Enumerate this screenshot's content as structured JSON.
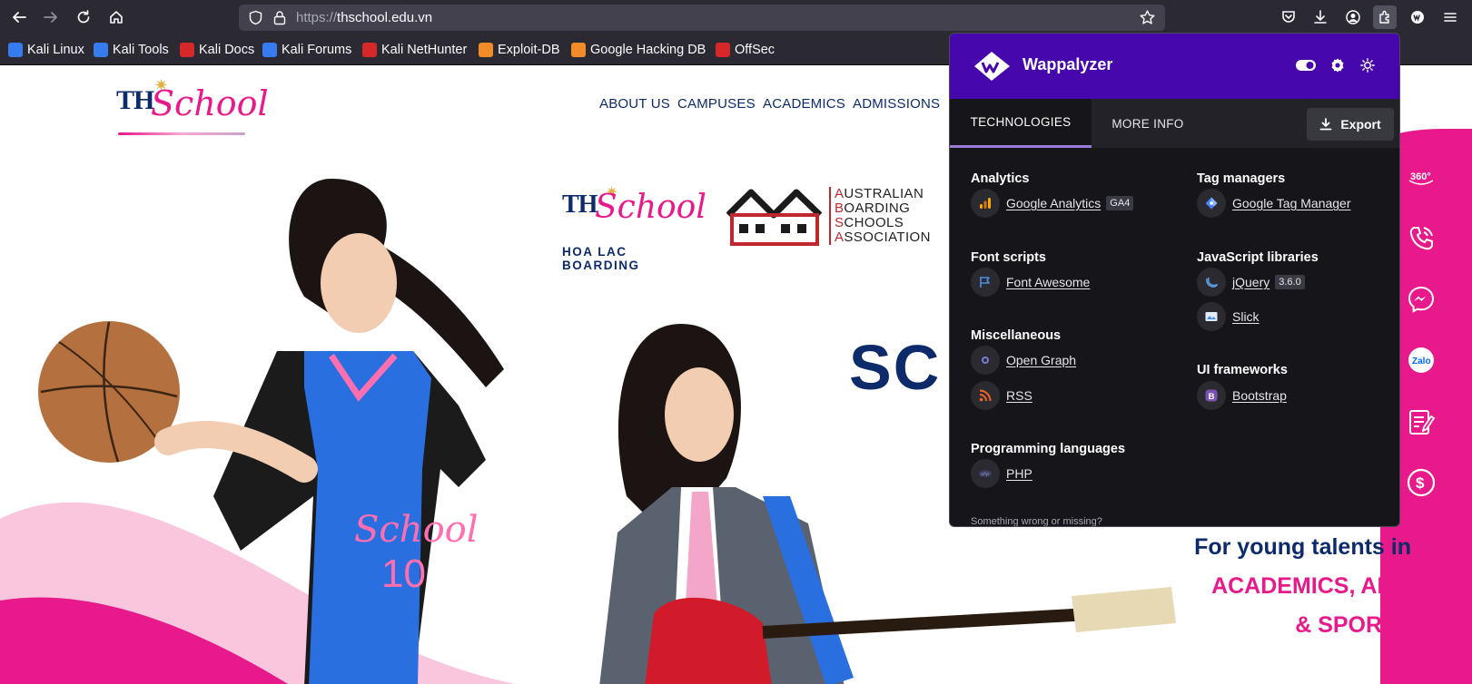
{
  "browser": {
    "url_scheme": "https://",
    "url_host": "thschool.edu.vn",
    "bookmarks": [
      {
        "label": "Kali Linux",
        "color": "#367bf0"
      },
      {
        "label": "Kali Tools",
        "color": "#367bf0"
      },
      {
        "label": "Kali Docs",
        "color": "#d62828"
      },
      {
        "label": "Kali Forums",
        "color": "#367bf0"
      },
      {
        "label": "Kali NetHunter",
        "color": "#d62828"
      },
      {
        "label": "Exploit-DB",
        "color": "#f28c28"
      },
      {
        "label": "Google Hacking DB",
        "color": "#f28c28"
      },
      {
        "label": "OffSec",
        "color": "#d62828"
      }
    ]
  },
  "site": {
    "logo_th": "TH",
    "logo_school": "School",
    "menu": [
      "ABOUT US",
      "CAMPUSES",
      "ACADEMICS",
      "ADMISSIONS"
    ],
    "badge_hlb": "HOA LAC BOARDING",
    "absa_lines": [
      {
        "first": "A",
        "rest": "USTRALIAN"
      },
      {
        "first": "B",
        "rest": "OARDING"
      },
      {
        "first": "S",
        "rest": "CHOOLS"
      },
      {
        "first": "A",
        "rest": "SSOCIATION"
      }
    ],
    "hero_partial": "SC",
    "tagline": [
      "For young talents in",
      "ACADEMICS, ART,",
      "& SPORTS"
    ],
    "side_icons": [
      "360-icon",
      "phone-icon",
      "messenger-icon",
      "zalo-icon",
      "form-icon",
      "dollar-icon"
    ],
    "zalo_label": "Zalo",
    "brand_pink": "#e8198b",
    "brand_navy": "#0d2b6b"
  },
  "wappalyzer": {
    "title": "Wappalyzer",
    "header_color": "#4608ad",
    "tabs": [
      "TECHNOLOGIES",
      "MORE INFO"
    ],
    "export_label": "Export",
    "categories": [
      {
        "title": "Analytics",
        "items": [
          {
            "name": "Google Analytics",
            "version": "GA4",
            "icon": "google-analytics-icon"
          }
        ]
      },
      {
        "title": "Font scripts",
        "items": [
          {
            "name": "Font Awesome",
            "version": "",
            "icon": "font-awesome-icon"
          }
        ]
      },
      {
        "title": "Miscellaneous",
        "items": [
          {
            "name": "Open Graph",
            "version": "",
            "icon": "open-graph-icon"
          },
          {
            "name": "RSS",
            "version": "",
            "icon": "rss-icon"
          }
        ]
      },
      {
        "title": "Programming languages",
        "items": [
          {
            "name": "PHP",
            "version": "",
            "icon": "php-icon"
          }
        ]
      },
      {
        "title": "Tag managers",
        "items": [
          {
            "name": "Google Tag Manager",
            "version": "",
            "icon": "google-tag-manager-icon"
          }
        ]
      },
      {
        "title": "JavaScript libraries",
        "items": [
          {
            "name": "jQuery",
            "version": "3.6.0",
            "icon": "jquery-icon"
          },
          {
            "name": "Slick",
            "version": "",
            "icon": "slick-icon"
          }
        ]
      },
      {
        "title": "UI frameworks",
        "items": [
          {
            "name": "Bootstrap",
            "version": "",
            "icon": "bootstrap-icon"
          }
        ]
      }
    ],
    "footer": "Something wrong or missing?"
  }
}
